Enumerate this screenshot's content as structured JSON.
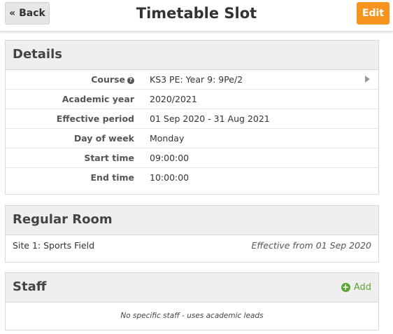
{
  "header": {
    "back_label": "« Back",
    "title": "Timetable Slot",
    "edit_label": "Edit",
    "edit_color": "#f7941d"
  },
  "details": {
    "title": "Details",
    "rows": [
      {
        "label": "Course",
        "value": "KS3 PE: Year 9: 9Pe/2",
        "help_icon": "question-circle-icon",
        "arrow_icon": "chevron-right-icon"
      },
      {
        "label": "Academic year",
        "value": "2020/2021"
      },
      {
        "label": "Effective period",
        "value": "01 Sep 2020 - 31 Aug 2021"
      },
      {
        "label": "Day of week",
        "value": "Monday"
      },
      {
        "label": "Start time",
        "value": "09:00:00"
      },
      {
        "label": "End time",
        "value": "10:00:00"
      }
    ]
  },
  "regular_room": {
    "title": "Regular Room",
    "room": "Site 1: Sports Field",
    "effective": "Effective from 01 Sep 2020"
  },
  "staff": {
    "title": "Staff",
    "add_label": "Add",
    "add_color": "#5aa52f",
    "empty_text": "No specific staff - uses academic leads"
  }
}
